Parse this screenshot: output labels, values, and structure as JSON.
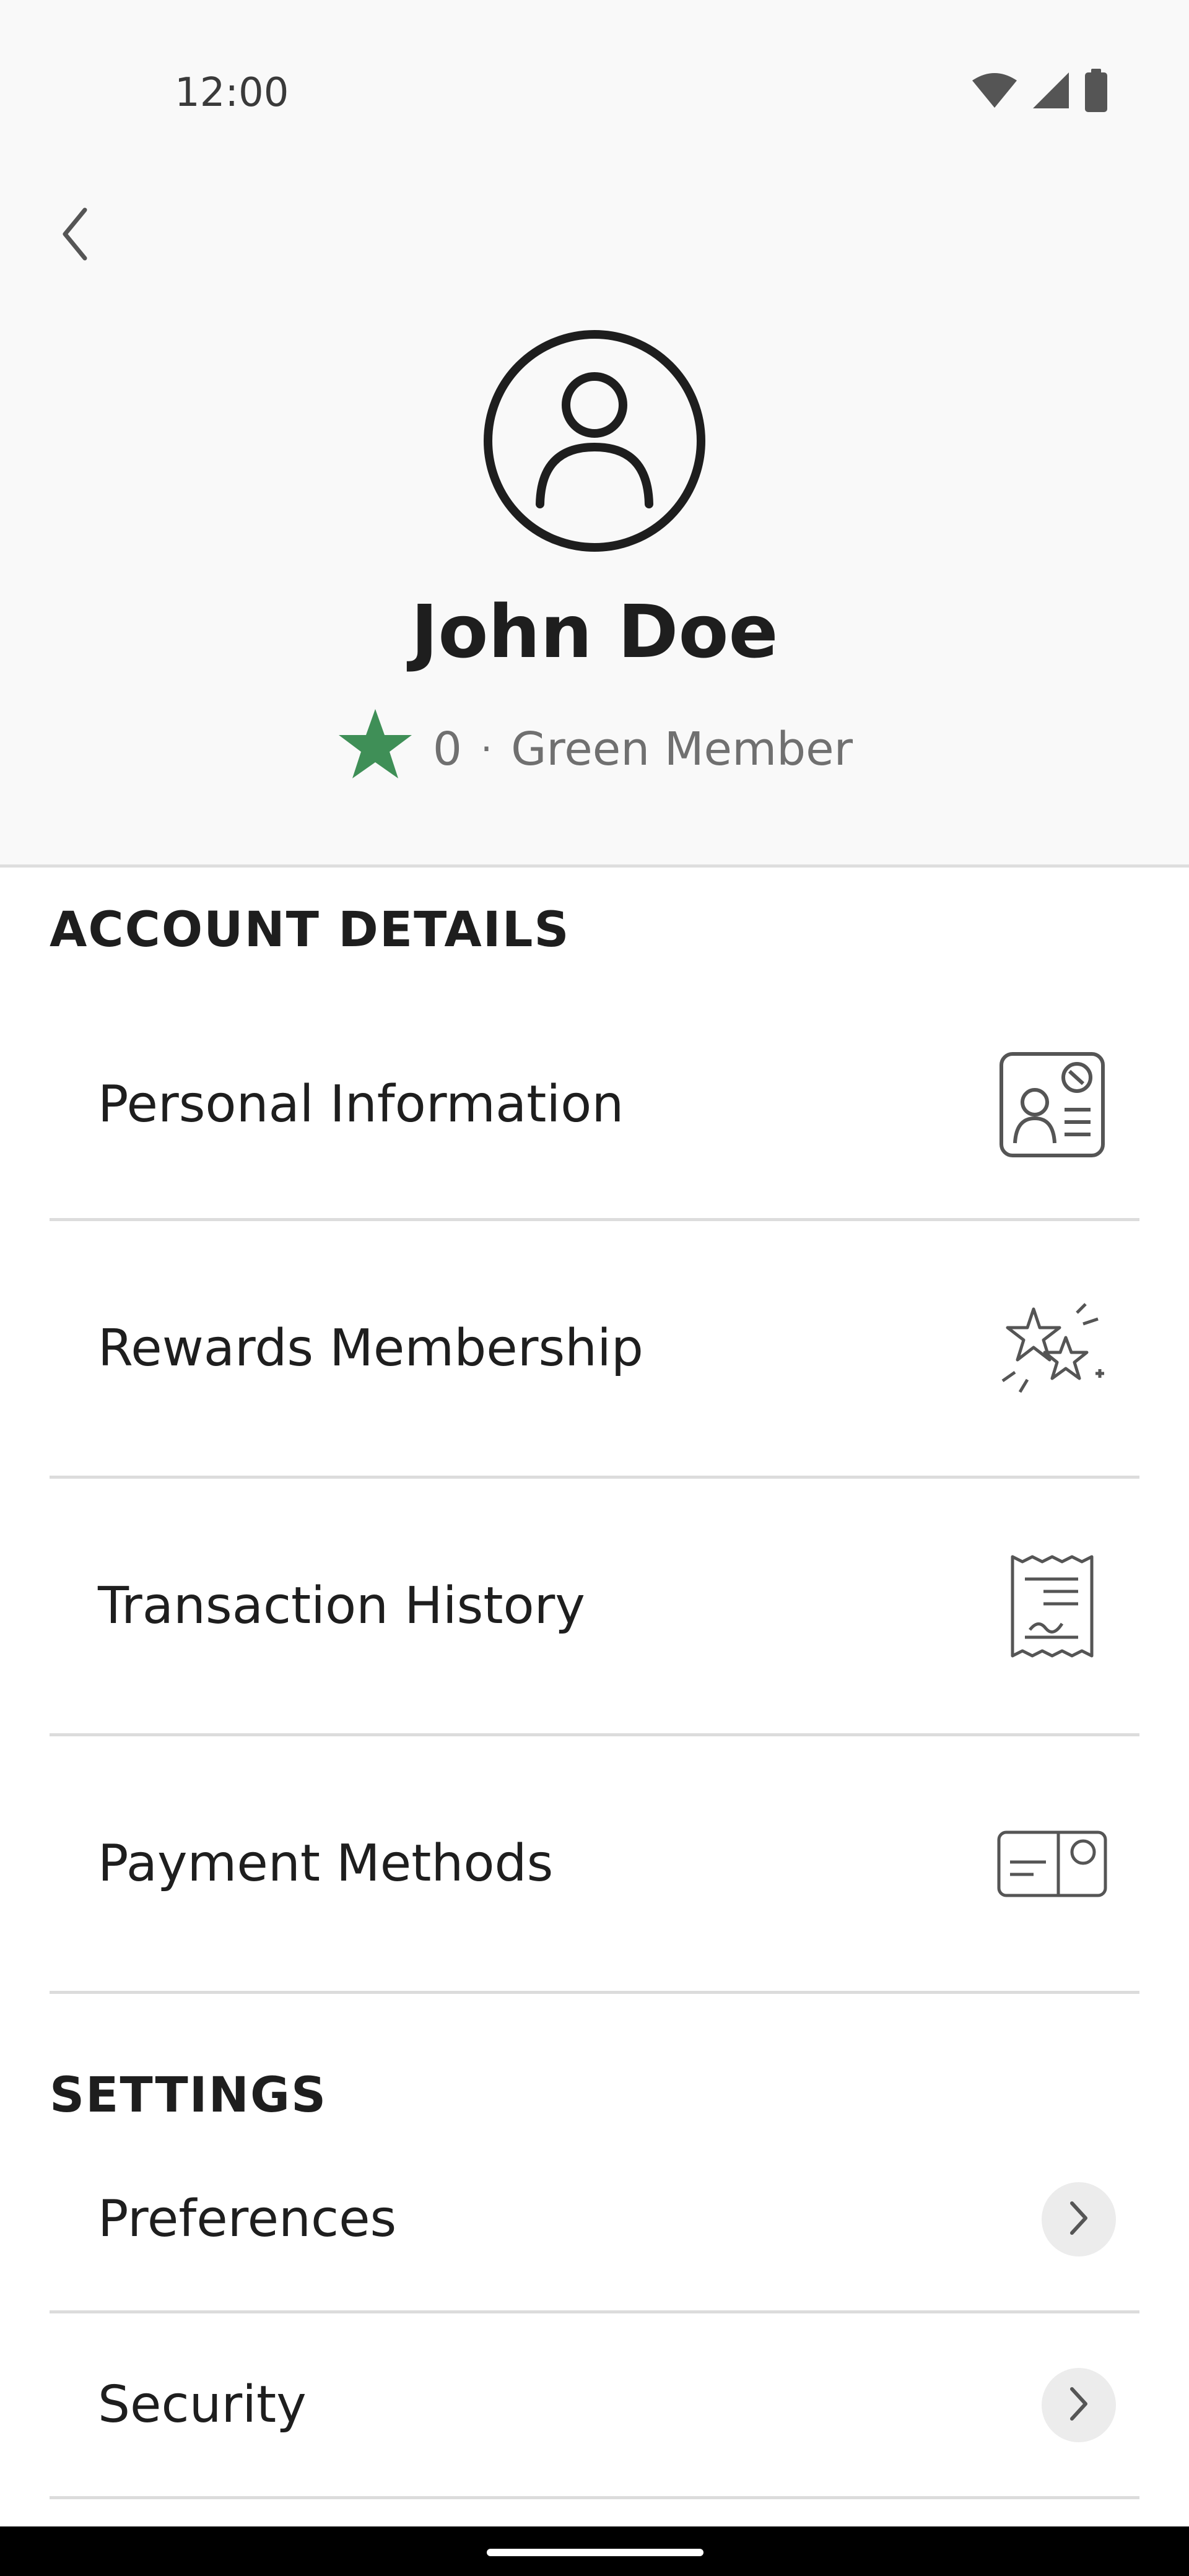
{
  "status_bar": {
    "time": "12:00",
    "icons": [
      "wifi-icon",
      "signal-icon",
      "battery-icon"
    ]
  },
  "header": {
    "back_icon": "chevron-left-icon",
    "avatar_icon": "user-circle-icon",
    "name": "John Doe",
    "star_count": "0",
    "separator": "·",
    "membership": "Green Member",
    "star_color": "#3f8f57"
  },
  "account_details": {
    "title": "ACCOUNT DETAILS",
    "items": [
      {
        "label": "Personal Information",
        "icon": "id-card-icon"
      },
      {
        "label": "Rewards Membership",
        "icon": "sparkle-stars-icon"
      },
      {
        "label": "Transaction History",
        "icon": "receipt-icon"
      },
      {
        "label": "Payment Methods",
        "icon": "payment-card-icon"
      }
    ]
  },
  "settings": {
    "title": "SETTINGS",
    "items": [
      {
        "label": "Preferences",
        "icon": "chevron-right-icon"
      },
      {
        "label": "Security",
        "icon": "chevron-right-icon"
      }
    ]
  }
}
